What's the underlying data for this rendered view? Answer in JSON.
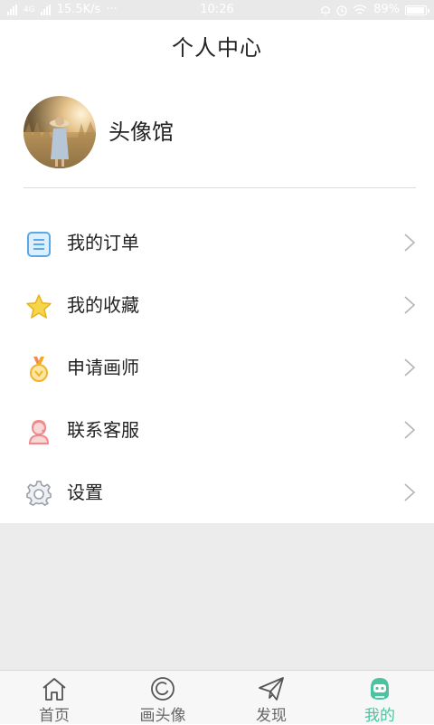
{
  "status_bar": {
    "network_speed": "15.5K/s",
    "dots": "···",
    "time": "10:26",
    "battery": "89%",
    "net_label": "4G"
  },
  "header": {
    "title": "个人中心"
  },
  "profile": {
    "name": "头像馆"
  },
  "menu": [
    {
      "label": "我的订单",
      "icon": "order-list-icon",
      "color": "#5aa9e6"
    },
    {
      "label": "我的收藏",
      "icon": "star-icon",
      "color": "#f5c518"
    },
    {
      "label": "申请画师",
      "icon": "medal-icon",
      "color": "#f0b429"
    },
    {
      "label": "联系客服",
      "icon": "customer-service-icon",
      "color": "#f08a8a"
    },
    {
      "label": "设置",
      "icon": "gear-icon",
      "color": "#9aa0aa"
    }
  ],
  "tabbar": {
    "items": [
      {
        "label": "首页",
        "icon": "home-icon"
      },
      {
        "label": "画头像",
        "icon": "draw-icon"
      },
      {
        "label": "发现",
        "icon": "paper-plane-icon"
      },
      {
        "label": "我的",
        "icon": "profile-icon",
        "active": true
      }
    ],
    "active_color": "#4cc3a0"
  }
}
